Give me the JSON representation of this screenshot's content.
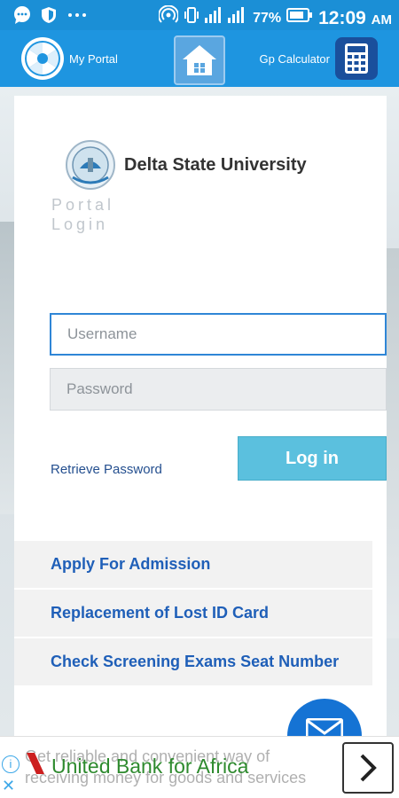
{
  "status_bar": {
    "battery": "77%",
    "time": "12:09",
    "ampm": "AM"
  },
  "nav": {
    "portal_label": "My Portal",
    "gp_label": "Gp Calculator"
  },
  "brand": {
    "university": "Delta State University",
    "portal_line1": "Portal",
    "portal_line2": "Login"
  },
  "form": {
    "username_placeholder": "Username",
    "password_placeholder": "Password",
    "retrieve_label": "Retrieve Password",
    "login_label": "Log in"
  },
  "links": [
    "Apply For Admission",
    "Replacement of Lost ID Card",
    "Check Screening Exams Seat Number"
  ],
  "ad": {
    "background_text_1": "Get reliable and convenient way of",
    "background_text_2": "receiving money for goods and services",
    "title": "United Bank for Africa"
  },
  "colors": {
    "primary": "#1e95e0",
    "login": "#5bc0de",
    "link": "#1f5fb8",
    "fab": "#1573d4"
  }
}
